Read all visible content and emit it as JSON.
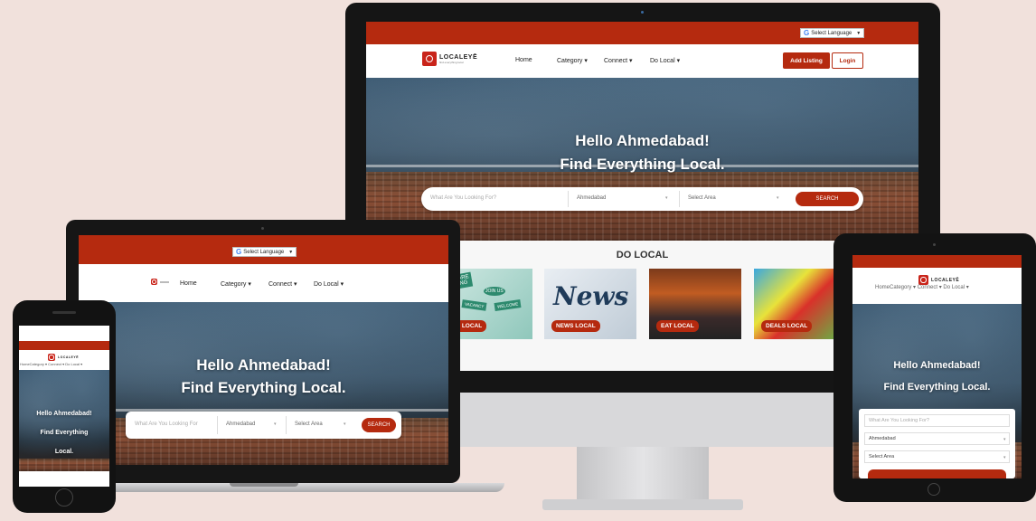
{
  "site": {
    "logo_text": "LOCALEYĒ",
    "logo_tagline": "find everything local",
    "lang_label": "Select Language",
    "lang_caret": "▼",
    "google_glyph": "G",
    "nav": {
      "home": "Home",
      "category": "Category",
      "connect": "Connect",
      "do_local": "Do Local",
      "dropdown_caret": "▾"
    },
    "add_listing": "Add Listing",
    "login": "Login",
    "hero_line1": "Hello Ahmedabad!",
    "hero_line2": "Find Everything Local.",
    "search_placeholder": "What Are You Looking For?",
    "search_placeholder_short": "What Are You Looking For",
    "city": "Ahmedabad",
    "area": "Select Area",
    "search_button": "SEARCH",
    "do_local_heading": "DO LOCAL",
    "do_local_cards": [
      {
        "label": "JOBS LOCAL",
        "visible_label": "BS LOCAL",
        "sign_texts": [
          "WE ARE",
          "HIRING",
          "JOIN US",
          "VACANCY",
          "WELCOME"
        ]
      },
      {
        "label": "NEWS LOCAL",
        "headline": "News"
      },
      {
        "label": "EAT LOCAL"
      },
      {
        "label": "DEALS LOCAL"
      }
    ]
  },
  "phone_hero": [
    "Hello Ahmedabad!",
    "Find Everything",
    "Local."
  ],
  "tablet_nav_text": "HomeCategory ▾ Connect ▾ Do Local ▾",
  "phone_nav_text": "HomeCategory ▾ Connect ▾ Do Local ▾",
  "colors": {
    "brand_red": "#b52a0f",
    "background": "#f1e1dc"
  }
}
